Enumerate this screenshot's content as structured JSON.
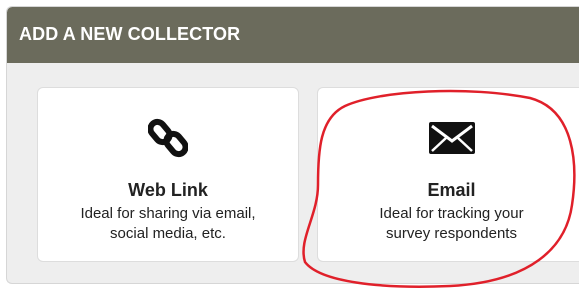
{
  "header": {
    "title": "ADD A NEW COLLECTOR"
  },
  "collectors": [
    {
      "icon": "link-icon",
      "title": "Web Link",
      "description_line1": "Ideal for sharing via email,",
      "description_line2": "social media, etc."
    },
    {
      "icon": "envelope-icon",
      "title": "Email",
      "description_line1": "Ideal for tracking your",
      "description_line2": "survey respondents"
    }
  ],
  "colors": {
    "header_bg": "#6b6b5c",
    "panel_bg": "#eeeeee",
    "card_bg": "#ffffff",
    "annotation": "#e0202a"
  }
}
